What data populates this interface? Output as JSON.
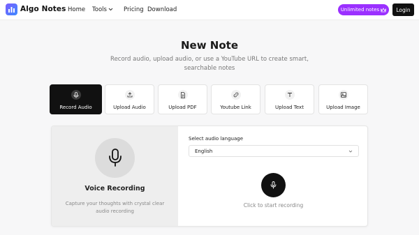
{
  "nav": {
    "brand": "Algo Notes",
    "links": [
      "Home",
      "Tools",
      "Pricing",
      "Download"
    ],
    "unlimited_label": "Unlimited notes",
    "login_label": "Login"
  },
  "header": {
    "title": "New Note",
    "subtitle": "Record audio, upload audio, or use a YouTube URL to create smart, searchable notes"
  },
  "tabs": [
    {
      "label": "Record Audio",
      "icon": "mic-icon"
    },
    {
      "label": "Upload Audio",
      "icon": "upload-icon"
    },
    {
      "label": "Upload PDF",
      "icon": "file-icon"
    },
    {
      "label": "Youtube Link",
      "icon": "link-icon"
    },
    {
      "label": "Upload Text",
      "icon": "text-icon"
    },
    {
      "label": "Upload Image",
      "icon": "image-icon"
    }
  ],
  "recorder": {
    "panel_title": "Voice Recording",
    "panel_description": "Capture your thoughts with crystal clear audio recording",
    "language_label": "Select audio language",
    "language_value": "English",
    "hint": "Click to start recording"
  },
  "colors": {
    "accent_purple": "#9b30ff",
    "dark": "#111111",
    "logo_gradient_start": "#7c5cff",
    "logo_gradient_end": "#3d8bff"
  }
}
